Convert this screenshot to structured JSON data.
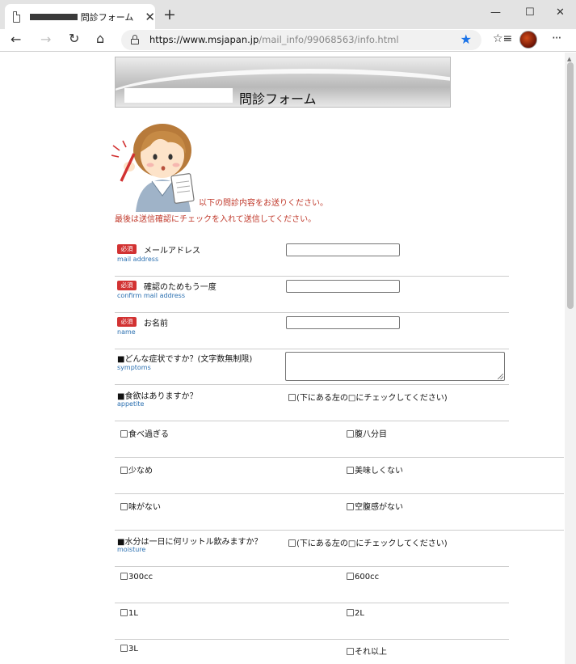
{
  "browser": {
    "tab_title": "問診フォーム",
    "tab_close": "✕",
    "new_tab": "+",
    "url_host": "https://www.msjapan.jp",
    "url_path": "/mail_info/99068563/info.html",
    "win_min": "—",
    "win_max": "☐",
    "win_close": "✕"
  },
  "page": {
    "banner_title": "問診フォーム",
    "intro_line1": "以下の問診内容をお送りください。",
    "intro_line2": "最後は送信確認にチェックを入れて送信してください。",
    "required_badge": "必須",
    "fields": {
      "email": {
        "label": "メールアドレス",
        "sub": "mail address"
      },
      "confirm": {
        "label": "確認のためもう一度",
        "sub": "confirm mail address"
      },
      "name": {
        "label": "お名前",
        "sub": "name"
      },
      "symptoms": {
        "label": "■どんな症状ですか？(文字数無制限)",
        "sub": "symptoms"
      },
      "appetite": {
        "label": "■食欲はありますか？",
        "sub": "appetite",
        "check_hint": "(下にある左の□にチェックしてください)"
      },
      "moisture": {
        "label": "■水分は一日に何リットル飲みますか？",
        "sub": "moisture",
        "check_hint": "(下にある左の□にチェックしてください)"
      }
    },
    "appetite_options": [
      "食べ過ぎる",
      "腹八分目",
      "少なめ",
      "美味しくない",
      "味がない",
      "空腹感がない"
    ],
    "moisture_options": [
      "300cc",
      "600cc",
      "1L",
      "2L",
      "3L",
      "それ以上"
    ]
  },
  "colors": {
    "accent_red": "#c0392b",
    "required_red": "#d23232",
    "sub_blue": "#2a6fb0",
    "bookmark_star": "#1a73e8"
  }
}
